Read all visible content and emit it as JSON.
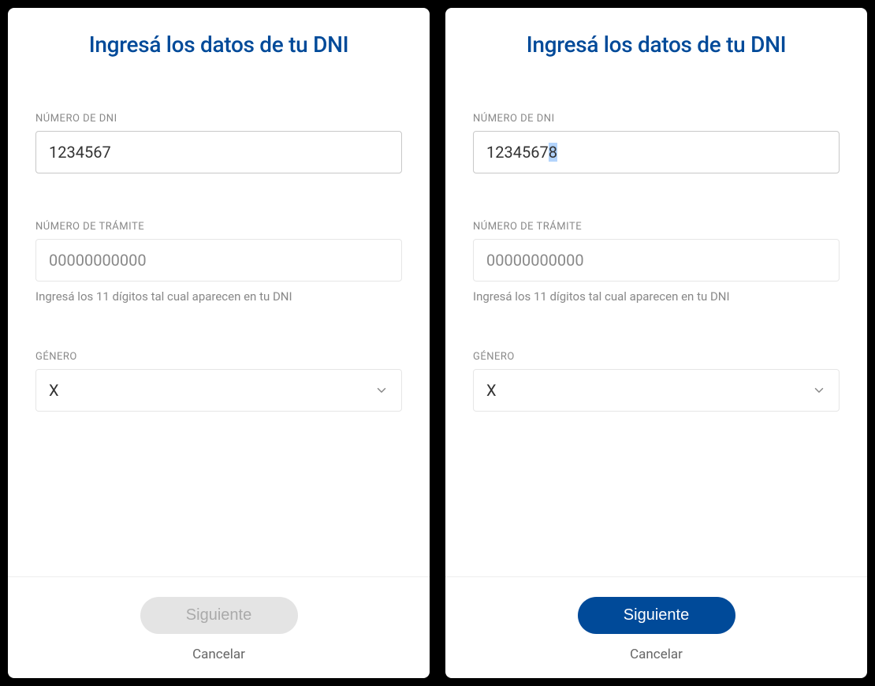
{
  "panels": [
    {
      "title": "Ingresá los datos de tu DNI",
      "dni": {
        "label": "NÚMERO DE DNI",
        "value_pre": "1234567",
        "value_sel": "",
        "value_post": ""
      },
      "tramite": {
        "label": "NÚMERO DE TRÁMITE",
        "placeholder": "00000000000",
        "helper": "Ingresá los 11 dígitos tal cual aparecen en tu DNI"
      },
      "genero": {
        "label": "GÉNERO",
        "value": "X"
      },
      "buttons": {
        "next": "Siguiente",
        "cancel": "Cancelar",
        "enabled": false
      }
    },
    {
      "title": "Ingresá los datos de tu DNI",
      "dni": {
        "label": "NÚMERO DE DNI",
        "value_pre": "1234567",
        "value_sel": "8",
        "value_post": ""
      },
      "tramite": {
        "label": "NÚMERO DE TRÁMITE",
        "placeholder": "00000000000",
        "helper": "Ingresá los 11 dígitos tal cual aparecen en tu DNI"
      },
      "genero": {
        "label": "GÉNERO",
        "value": "X"
      },
      "buttons": {
        "next": "Siguiente",
        "cancel": "Cancelar",
        "enabled": true
      }
    }
  ],
  "colors": {
    "brand": "#004a99"
  }
}
